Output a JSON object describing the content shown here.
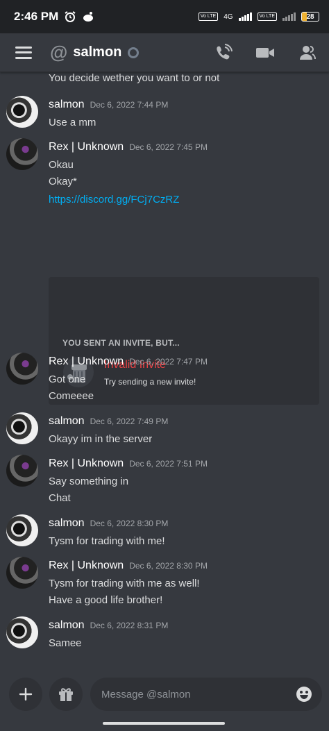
{
  "status_bar": {
    "time": "2:46 PM",
    "network": "4G",
    "volte_label": "Vo LTE",
    "battery": "28",
    "battery_level": 0.28
  },
  "header": {
    "channel_name": "salmon",
    "icons": [
      "menu-icon",
      "at-icon",
      "call-icon",
      "video-icon",
      "members-icon"
    ]
  },
  "messages": {
    "continued_text": "You decide wether you want to or not",
    "items": [
      {
        "author": "salmon",
        "timestamp": "Dec 6, 2022 7:44 PM",
        "lines": [
          "Use a mm"
        ]
      },
      {
        "author": "Rex | Unknown",
        "timestamp": "Dec 6, 2022 7:45 PM",
        "lines": [
          "Okau",
          "Okay*"
        ],
        "link": "https://discord.gg/FCj7CzRZ",
        "invite": {
          "title": "YOU SENT AN INVITE, BUT...",
          "name": "Invalid Invite",
          "sub": "Try sending a new invite!"
        }
      },
      {
        "author": "Rex | Unknown",
        "timestamp": "Dec 6, 2022 7:47 PM",
        "lines": [
          "Got one",
          "Comeeee"
        ]
      },
      {
        "author": "salmon",
        "timestamp": "Dec 6, 2022 7:49 PM",
        "lines": [
          "Okayy im in the server"
        ]
      },
      {
        "author": "Rex | Unknown",
        "timestamp": "Dec 6, 2022 7:51 PM",
        "lines": [
          "Say something in",
          "Chat"
        ]
      },
      {
        "author": "salmon",
        "timestamp": "Dec 6, 2022 8:30 PM",
        "lines": [
          "Tysm for trading with me!"
        ]
      },
      {
        "author": "Rex | Unknown",
        "timestamp": "Dec 6, 2022 8:30 PM",
        "lines": [
          "Tysm for trading with me as well!",
          "Have a good life brother!"
        ]
      },
      {
        "author": "salmon",
        "timestamp": "Dec 6, 2022 8:31 PM",
        "lines": [
          "Samee"
        ]
      }
    ]
  },
  "composer": {
    "placeholder": "Message @salmon"
  }
}
